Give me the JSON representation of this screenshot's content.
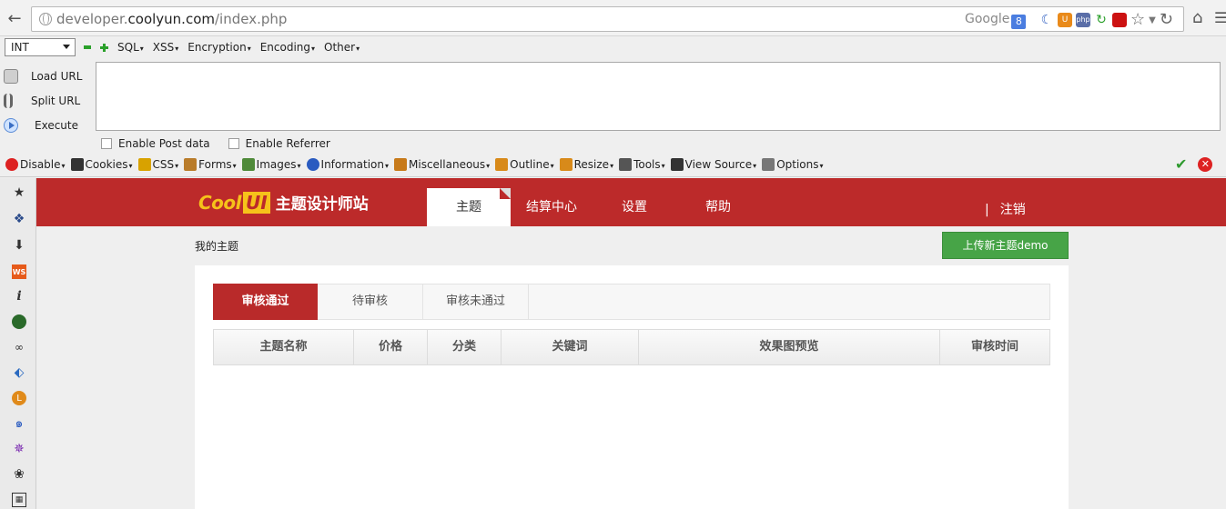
{
  "browser": {
    "url_prefix": "developer.",
    "url_host": "coolyun.com",
    "url_path": "/index.php",
    "search_engine": "Google",
    "search_badge": "8"
  },
  "hackbar": {
    "select_value": "INT",
    "menu": [
      "SQL",
      "XSS",
      "Encryption",
      "Encoding",
      "Other"
    ],
    "actions": [
      "Load URL",
      "Split URL",
      "Execute"
    ],
    "checkboxes": [
      "Enable Post data",
      "Enable Referrer"
    ]
  },
  "webdev_toolbar": {
    "items": [
      {
        "label": "Disable",
        "icon": "disable-icon",
        "color": "#d22"
      },
      {
        "label": "Cookies",
        "icon": "cookies-icon",
        "color": "#333"
      },
      {
        "label": "CSS",
        "icon": "css-icon",
        "color": "#d8a200"
      },
      {
        "label": "Forms",
        "icon": "forms-icon",
        "color": "#b97c2a"
      },
      {
        "label": "Images",
        "icon": "images-icon",
        "color": "#4f8a3a"
      },
      {
        "label": "Information",
        "icon": "information-icon",
        "color": "#2a5bc0"
      },
      {
        "label": "Miscellaneous",
        "icon": "miscellaneous-icon",
        "color": "#c77a1a"
      },
      {
        "label": "Outline",
        "icon": "outline-icon",
        "color": "#d88a1a"
      },
      {
        "label": "Resize",
        "icon": "resize-icon",
        "color": "#d88a1a"
      },
      {
        "label": "Tools",
        "icon": "tools-icon",
        "color": "#555"
      },
      {
        "label": "View Source",
        "icon": "view-source-icon",
        "color": "#333"
      },
      {
        "label": "Options",
        "icon": "options-icon",
        "color": "#777"
      }
    ]
  },
  "site": {
    "logo_cool": "Cool",
    "logo_ui": "UI",
    "logo_cn": "主题设计师站",
    "nav": [
      "主题",
      "结算中心",
      "设置",
      "帮助"
    ],
    "logout_sep": "|",
    "logout": "注销",
    "my_title": "我的主题",
    "upload_button": "上传新主题demo",
    "tabs": [
      "审核通过",
      "待审核",
      "审核未通过"
    ],
    "columns": [
      "主题名称",
      "价格",
      "分类",
      "关键词",
      "效果图预览",
      "审核时间"
    ]
  },
  "colors": {
    "header_red": "#bc2a2a",
    "tab_active": "#b92a2a",
    "upload_green": "#47a447"
  }
}
